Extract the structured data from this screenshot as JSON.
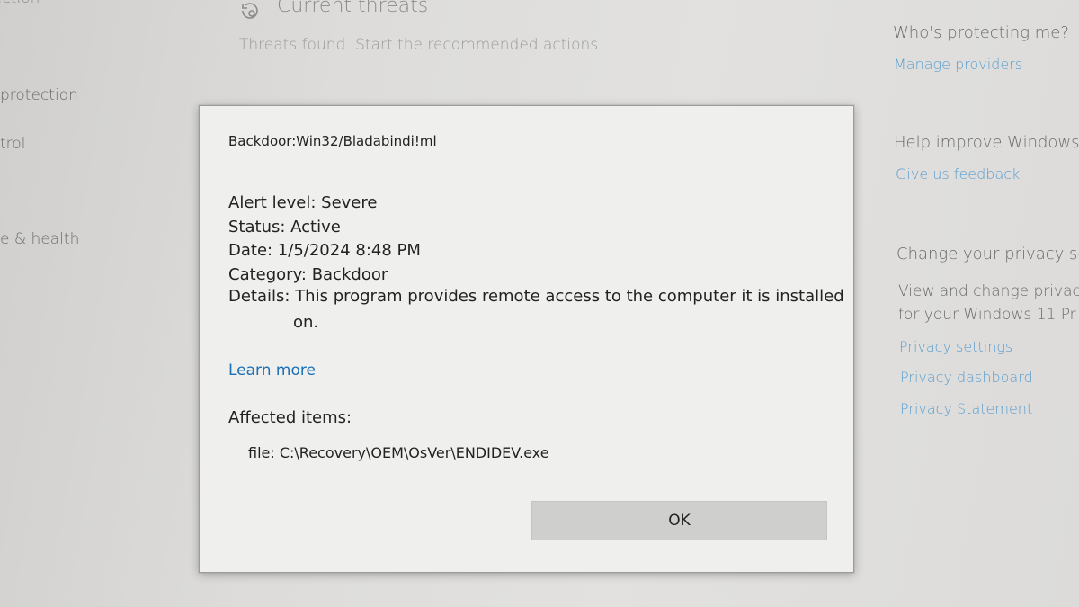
{
  "left_nav": {
    "item1": "ection",
    "item2": "protection",
    "item3": "trol",
    "item4": "e & health"
  },
  "main": {
    "icon": "threat-refresh-icon",
    "heading": "Current threats",
    "subtitle": "Threats found. Start the recommended actions."
  },
  "right_panel": {
    "protecting_heading": "Who's protecting me?",
    "manage_providers": "Manage providers",
    "improve_heading": "Help improve Windows",
    "feedback_link": "Give us feedback",
    "privacy_heading": "Change your privacy se",
    "privacy_text_1": "View and change privac",
    "privacy_text_2": "for your Windows 11 Pr",
    "privacy_settings": "Privacy settings",
    "privacy_dashboard": "Privacy dashboard",
    "privacy_statement": "Privacy Statement"
  },
  "dialog": {
    "threat_name": "Backdoor:Win32/Bladabindi!ml",
    "alert_level": "Alert level: Severe",
    "status": "Status: Active",
    "date": "Date: 1/5/2024 8:48 PM",
    "category": "Category: Backdoor",
    "details_line1": "Details: This program provides remote access to the computer it is installed",
    "details_line2": "on.",
    "learn_more": "Learn more",
    "affected_label": "Affected items:",
    "affected_file": "file: C:\\Recovery\\OEM\\OsVer\\ENDIDEV.exe",
    "ok_label": "OK"
  },
  "colors": {
    "link": "#1a6fb5",
    "background_link": "#5a9fd0",
    "dialog_bg": "#efefed",
    "button_bg": "#cfcfcd"
  }
}
